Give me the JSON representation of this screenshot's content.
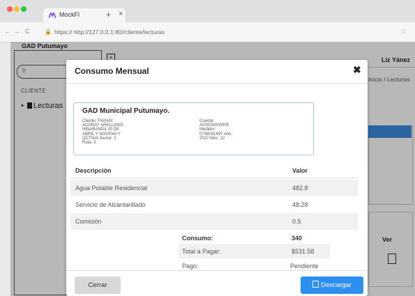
{
  "browser": {
    "tab_title": "MockFl",
    "tab_plus": "+",
    "tab_close": "×",
    "nav_back": "←",
    "nav_forward": "→",
    "nav_reload": "C",
    "url": "https://  http://127.0.0.1:80//cliente/lecturas",
    "star": "☆",
    "traffic_colors": [
      "#ff5f57",
      "#febc2e",
      "#28c840"
    ]
  },
  "sidebar": {
    "brand": "GAD Putumayo",
    "search_icon": "search-icon",
    "section": "CLIENTE",
    "item_label": "Lecturas",
    "item_bullet": "•"
  },
  "app": {
    "user": "Liz Yánez",
    "breadcrumb": "Inicio / Lecturas",
    "ver_label": "Ver",
    "accent": "#3b8be0"
  },
  "modal": {
    "title": "Consumo Mensual",
    "close": "✖",
    "org": "GAD Municipal Putumayo.",
    "info_left": [
      "Cliente: FAVIAN",
      "ADONAY ARELLANO",
      "NINABANDA 30 DE",
      "ABRIL Y NOVENA Y",
      "OCTAVA Sector: 2",
      "Ruta: 3"
    ],
    "info_right": [
      "Cuenta:",
      "AG0030000005",
      "Medidor:",
      "0708031497 Año:",
      "2022 Mes: 12"
    ],
    "col_desc": "Descripción",
    "col_val": "Valor",
    "rows": [
      {
        "desc": "Agua Potable Residencial",
        "val": "482.8"
      },
      {
        "desc": "Servicio de Alcantarillado",
        "val": "48.28"
      },
      {
        "desc": "Comisión",
        "val": "0.5"
      }
    ],
    "consumo_label": "Consumo:",
    "consumo_value": "340",
    "total_label": "Total a Pagar:",
    "total_value": "$531.58",
    "pago_label": "Pago:",
    "pago_value": "Pendiente",
    "btn_close": "Cerrar",
    "btn_download": "Descargar",
    "download_color": "#2d8ff0"
  }
}
